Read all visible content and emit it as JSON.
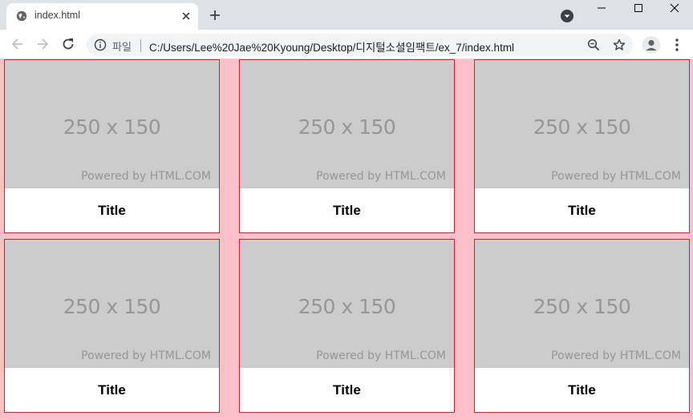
{
  "browser": {
    "tab": {
      "title": "index.html",
      "favicon": "globe-icon"
    },
    "address_bar": {
      "chip_label": "파일",
      "url": "C:/Users/Lee%20Jae%20Kyoung/Desktop/디지털소셜임팩트/ex_7/index.html"
    },
    "icons": {
      "back": "arrow-left-icon",
      "forward": "arrow-right-icon",
      "reload": "reload-icon",
      "info": "info-icon",
      "zoom": "zoom-out-icon",
      "bookmark": "star-icon",
      "profile": "avatar-icon",
      "menu": "kebab-menu-icon"
    }
  },
  "page": {
    "background_color": "#ffc0cb",
    "card_border_color": "#e01b1b",
    "placeholder_color": "#cccccc",
    "cards": [
      {
        "image_text": "250 x 150",
        "image_caption": "Powered by HTML.COM",
        "title": "Title"
      },
      {
        "image_text": "250 x 150",
        "image_caption": "Powered by HTML.COM",
        "title": "Title"
      },
      {
        "image_text": "250 x 150",
        "image_caption": "Powered by HTML.COM",
        "title": "Title"
      },
      {
        "image_text": "250 x 150",
        "image_caption": "Powered by HTML.COM",
        "title": "Title"
      },
      {
        "image_text": "250 x 150",
        "image_caption": "Powered by HTML.COM",
        "title": "Title"
      },
      {
        "image_text": "250 x 150",
        "image_caption": "Powered by HTML.COM",
        "title": "Title"
      }
    ]
  }
}
